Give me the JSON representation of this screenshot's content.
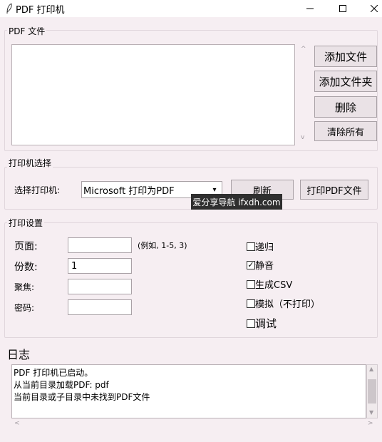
{
  "window": {
    "title": "PDF 打印机",
    "minimize": "—",
    "maximize": "☐",
    "close": "✕"
  },
  "pdf_files": {
    "section_title": "PDF 文件",
    "buttons": {
      "add_file": "添加文件",
      "add_folder": "添加文件夹",
      "delete": "删除",
      "clear_all": "清除所有"
    },
    "scroll_up": "^",
    "scroll_down": "v"
  },
  "printer": {
    "section_title": "打印机选择",
    "label": "选择打印机:",
    "selected": "Microsoft 打印为PDF",
    "refresh": "刷新",
    "print_pdf": "打印PDF文件",
    "tooltip": "爱分享导航 ifxdh.com"
  },
  "settings": {
    "section_title": "打印设置",
    "pages_label": "页面:",
    "pages_value": "",
    "pages_hint": "(例如, 1-5, 3)",
    "copies_label": "份数:",
    "copies_value": "1",
    "collate_label": "聚焦:",
    "collate_value": "",
    "password_label": "密码:",
    "password_value": "",
    "checkboxes": [
      {
        "label": "递归",
        "checked": false
      },
      {
        "label": "静音",
        "checked": true
      },
      {
        "label": "生成CSV",
        "checked": false
      },
      {
        "label": "模拟（不打印）",
        "checked": false
      },
      {
        "label": "调试",
        "checked": false
      }
    ]
  },
  "log": {
    "title": "日志",
    "lines": [
      "PDF 打印机已启动。",
      "从当前目录加载PDF: pdf",
      "当前目录或子目录中未找到PDF文件"
    ],
    "scroll_left": "<",
    "scroll_right": ">"
  }
}
